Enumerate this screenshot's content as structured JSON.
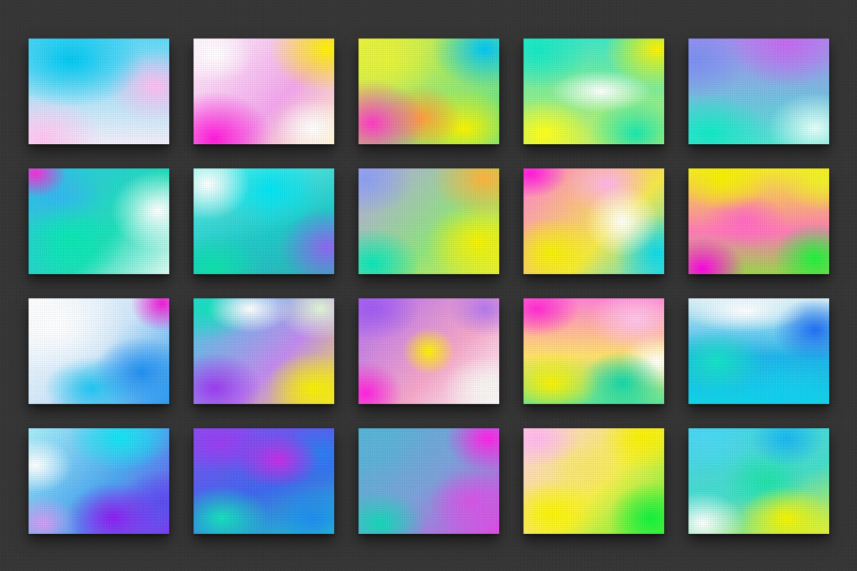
{
  "page": {
    "background_color": "#343434"
  },
  "swatches": [
    {
      "index": 1,
      "palette": [
        "#00c8f2",
        "#ffc4f2",
        "#f3eefa"
      ]
    },
    {
      "index": 2,
      "palette": [
        "#fff200",
        "#ff1ad9",
        "#ffffff"
      ]
    },
    {
      "index": 3,
      "palette": [
        "#00c6f5",
        "#ff39c6",
        "#ff9e3a",
        "#f9f300"
      ]
    },
    {
      "index": 4,
      "palette": [
        "#14e8c4",
        "#fff200",
        "#ffffff",
        "#19e6b0"
      ]
    },
    {
      "index": 5,
      "palette": [
        "#c46af0",
        "#7a8ff2",
        "#12e8c6",
        "#e7fff9"
      ]
    },
    {
      "index": 6,
      "palette": [
        "#f52fd6",
        "#34b7ef",
        "#08e7b2",
        "#ffffff"
      ]
    },
    {
      "index": 7,
      "palette": [
        "#ffffff",
        "#00e4f2",
        "#8d66f0",
        "#0ee2aa"
      ]
    },
    {
      "index": 8,
      "palette": [
        "#8aa0f2",
        "#ffb33a",
        "#f5f200",
        "#07e6b9"
      ]
    },
    {
      "index": 9,
      "palette": [
        "#ff1ad8",
        "#ffb5e8",
        "#f5f200",
        "#0fd8e6"
      ]
    },
    {
      "index": 10,
      "palette": [
        "#f6f000",
        "#ff00e6",
        "#ff6ac2",
        "#1ef23c"
      ]
    },
    {
      "index": 11,
      "palette": [
        "#ffffff",
        "#f01ad6",
        "#1f8ff2",
        "#20c6f2"
      ]
    },
    {
      "index": 12,
      "palette": [
        "#12e0bc",
        "#9a3cf0",
        "#f8f000",
        "#ffffff"
      ]
    },
    {
      "index": 13,
      "palette": [
        "#a05af2",
        "#fff200",
        "#ff22dc",
        "#f6f6f2"
      ]
    },
    {
      "index": 14,
      "palette": [
        "#ff2ad2",
        "#ffc4ec",
        "#f9f200",
        "#12d7a8"
      ]
    },
    {
      "index": 15,
      "palette": [
        "#ffffff",
        "#1f6ff2",
        "#16e2c4",
        "#14cdf0"
      ]
    },
    {
      "index": 16,
      "palette": [
        "#ffffff",
        "#11e4f2",
        "#8b1ef0",
        "#5a4cf0"
      ]
    },
    {
      "index": 17,
      "palette": [
        "#9a3cf0",
        "#2a7ef0",
        "#14e0bc",
        "#1e8cf0"
      ]
    },
    {
      "index": 18,
      "palette": [
        "#5ab2d8",
        "#ff22e6",
        "#d654e6",
        "#14d6b8"
      ]
    },
    {
      "index": 19,
      "palette": [
        "#ffb8ec",
        "#f8f000",
        "#fbf400",
        "#12f23c"
      ]
    },
    {
      "index": 20,
      "palette": [
        "#4ad8f2",
        "#18b6f0",
        "#ffffff",
        "#f4f400"
      ]
    }
  ]
}
